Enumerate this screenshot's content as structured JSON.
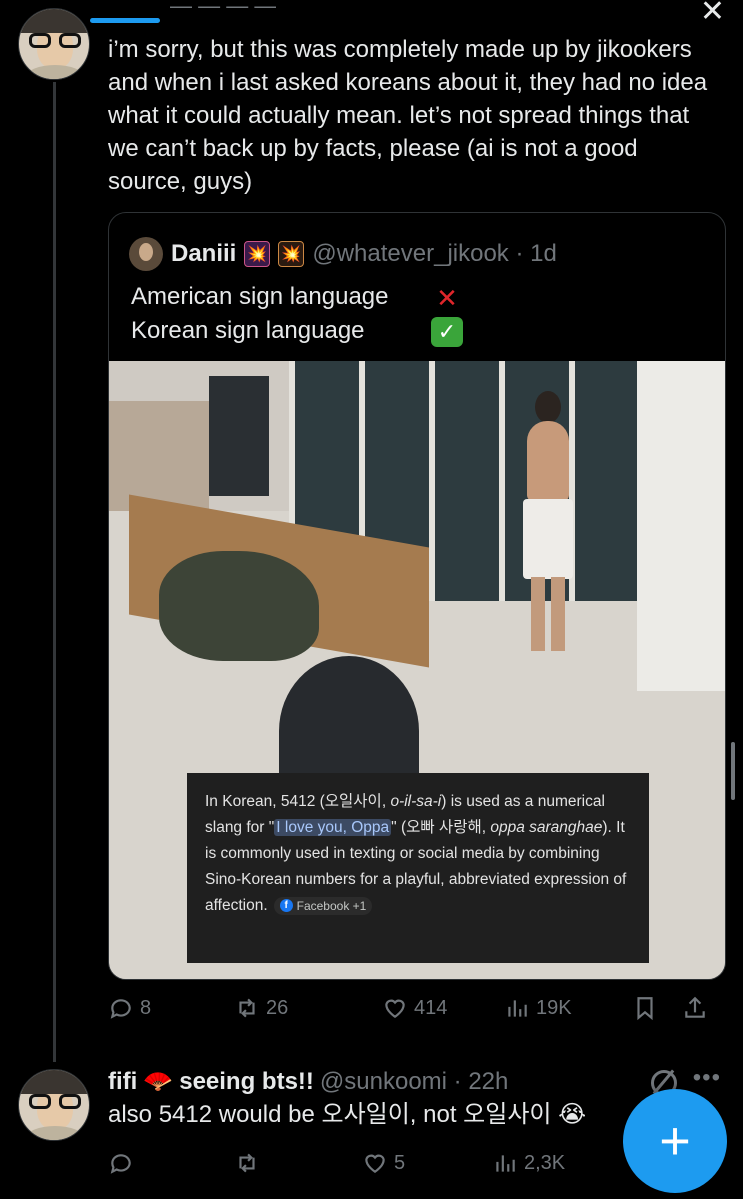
{
  "top_partial": "— — — —",
  "tweet1": {
    "text": "i’m sorry, but this was completely made up by jikookers and when i last asked koreans about it, they had no idea what it could actually mean. let’s not spread things that we can’t back up by facts, please (ai is not a good source, guys)",
    "quote": {
      "name": "Daniii",
      "badge1": "💥",
      "badge2": "💥",
      "handle_time": "@whatever_jikook · 1d",
      "line1": "American sign language",
      "mark1": "✕",
      "line2": "Korean sign language",
      "mark2": "✓",
      "caption": {
        "p1": "In Korean, 5412 (오일사이, ",
        "p1_italic": "o-il-sa-i",
        "p2": ") is used as a numerical slang for \"",
        "highlight": "I love you, Oppa",
        "p3": "\" (오빠 사랑해, ",
        "p3_italic": "oppa saranghae",
        "p4": "). It is commonly used in texting or social media by combining Sino-Korean numbers for a playful, abbreviated expression of affection.",
        "source": "Facebook +1"
      }
    },
    "actions": {
      "replies": "8",
      "reposts": "26",
      "likes": "414",
      "views": "19K"
    }
  },
  "tweet2": {
    "name": "fifi",
    "emoji": "🪭",
    "status": "seeing bts!!",
    "handle_time": "@sunkoomi · 22h",
    "text": "also 5412 would be 오사일이, not 오일사이 😭",
    "actions": {
      "replies": "",
      "reposts": "",
      "likes": "5",
      "views": "2,3K"
    }
  },
  "fab_label": "+",
  "colors": {
    "accent": "#1d9bf0",
    "muted": "#71767b",
    "text": "#e7e9ea",
    "border": "#2f3336"
  }
}
